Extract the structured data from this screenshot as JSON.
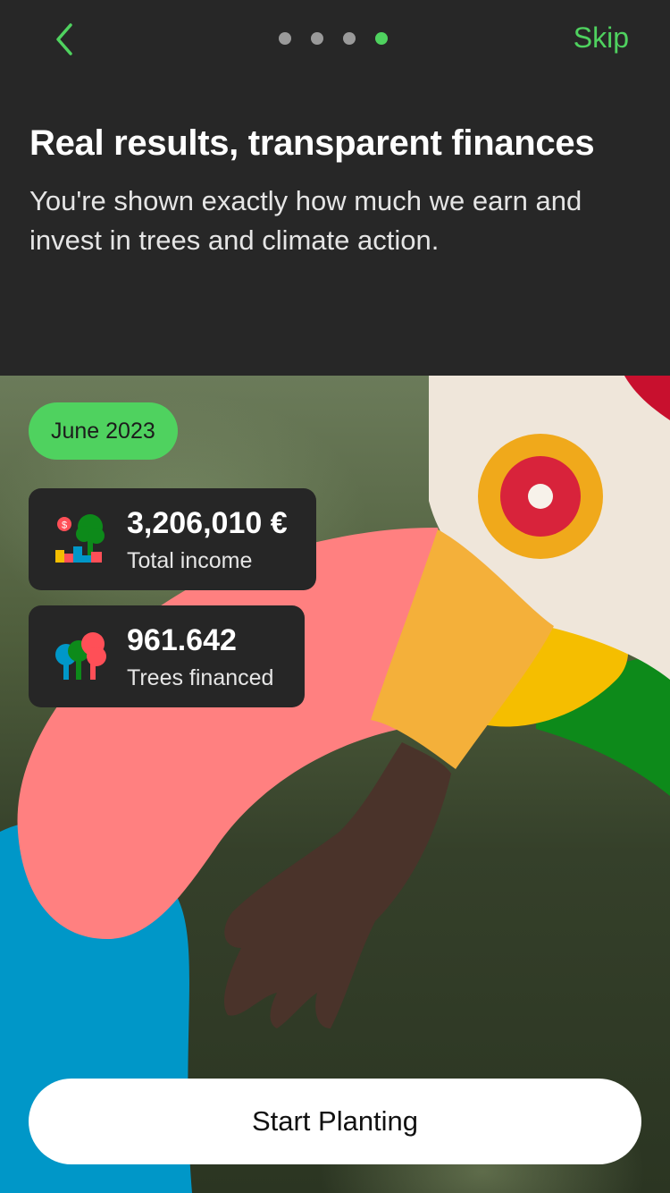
{
  "header": {
    "back_icon": "chevron-left-icon",
    "skip_label": "Skip",
    "pager": {
      "count": 4,
      "active_index": 3
    }
  },
  "intro": {
    "title": "Real results, transparent finances",
    "subtitle": "You're shown exactly how much we earn and invest in trees and climate action."
  },
  "report": {
    "period": "June 2023",
    "stats": [
      {
        "value": "3,206,010 €",
        "label": "Total income",
        "icon": "income-chart-icon"
      },
      {
        "value": "961.642",
        "label": "Trees financed",
        "icon": "trees-icon"
      }
    ]
  },
  "cta": {
    "label": "Start Planting"
  },
  "colors": {
    "accent": "#4fd25f",
    "background": "#272727",
    "card": "#262626",
    "pink": "#ff8080",
    "blue": "#0097c8",
    "yellow": "#f5be00",
    "green": "#0d8a1a"
  }
}
